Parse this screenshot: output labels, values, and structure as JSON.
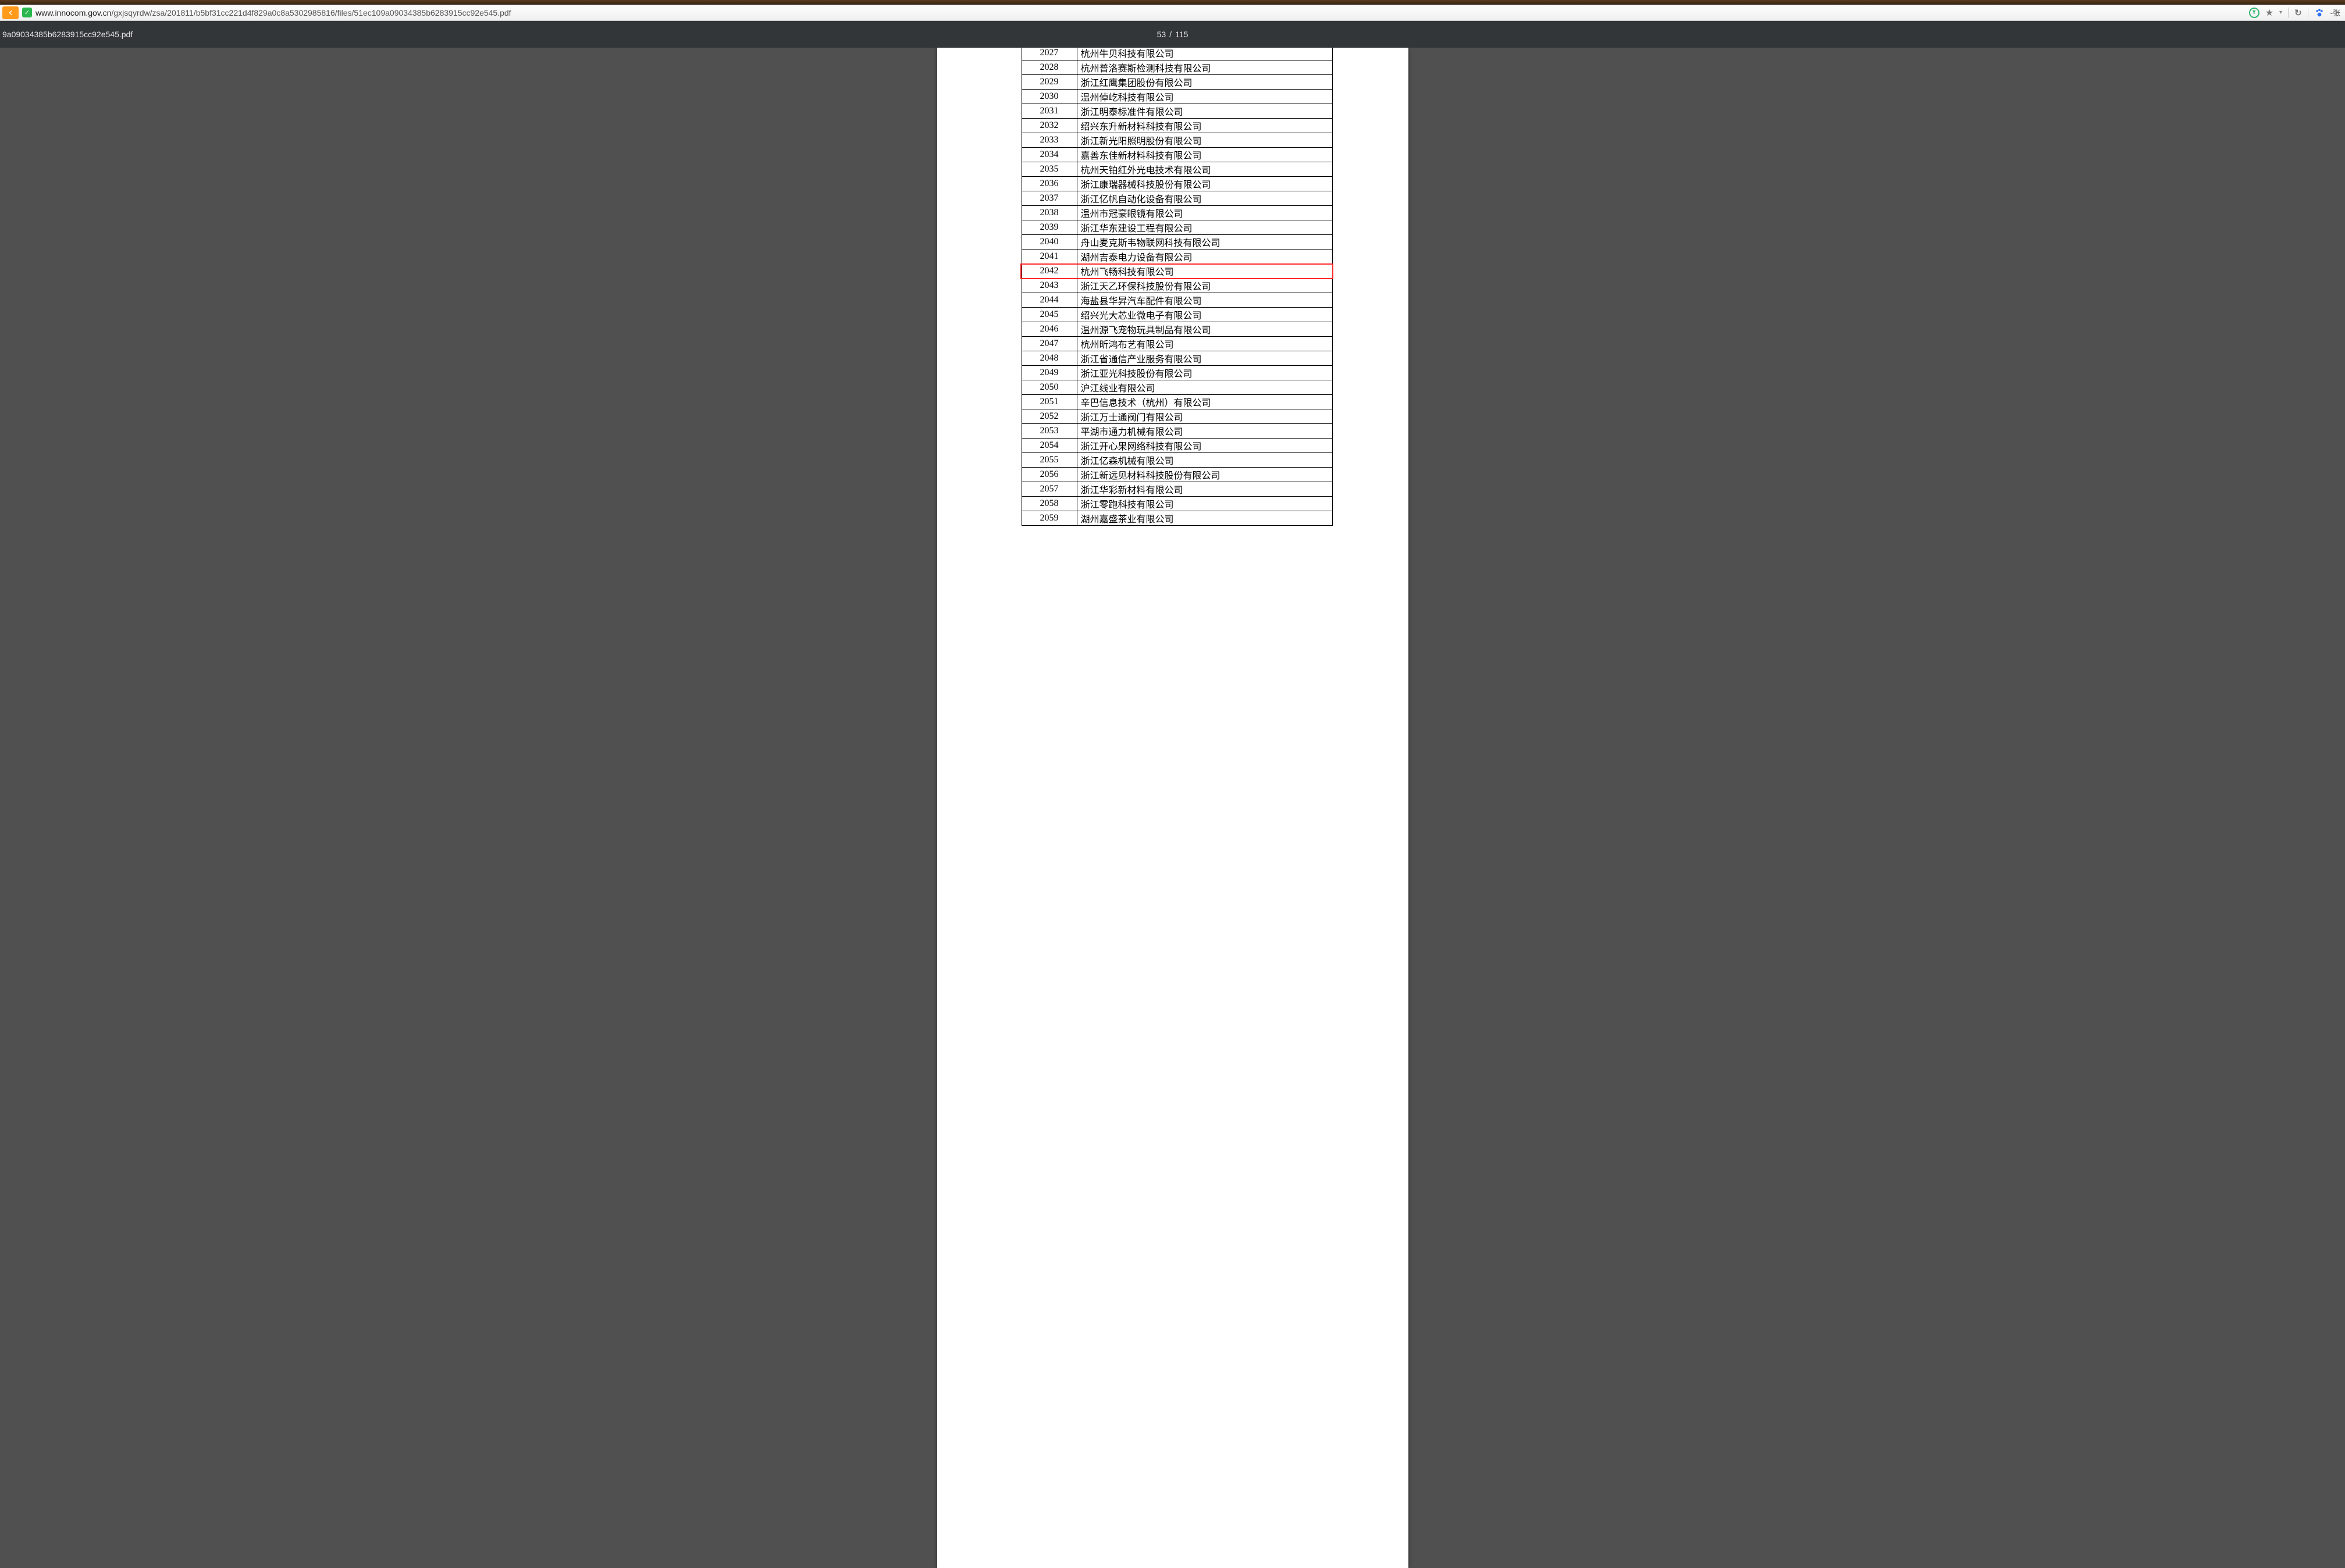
{
  "browser": {
    "url_domain": "www.innocom.gov.cn",
    "url_path": "/gxjsqyrdw/zsa/201811/b5bf31cc221d4f829a0c8a5302985816/files/51ec109a09034385b6283915cc92e545.pdf",
    "user_label": "张"
  },
  "pdf": {
    "title": "9a09034385b6283915cc92e545.pdf",
    "page_current": "53",
    "page_sep": "/",
    "page_total": "115"
  },
  "highlighted_row_number": "2042",
  "rows": [
    {
      "n": "2027",
      "name": "杭州牛贝科技有限公司"
    },
    {
      "n": "2028",
      "name": "杭州普洛赛斯检测科技有限公司"
    },
    {
      "n": "2029",
      "name": "浙江红鹰集团股份有限公司"
    },
    {
      "n": "2030",
      "name": "温州倬屹科技有限公司"
    },
    {
      "n": "2031",
      "name": "浙江明泰标准件有限公司"
    },
    {
      "n": "2032",
      "name": "绍兴东升新材料科技有限公司"
    },
    {
      "n": "2033",
      "name": "浙江新光阳照明股份有限公司"
    },
    {
      "n": "2034",
      "name": "嘉善东佳新材料科技有限公司"
    },
    {
      "n": "2035",
      "name": "杭州天铂红外光电技术有限公司"
    },
    {
      "n": "2036",
      "name": "浙江康瑞器械科技股份有限公司"
    },
    {
      "n": "2037",
      "name": "浙江亿帆自动化设备有限公司"
    },
    {
      "n": "2038",
      "name": "温州市冠豪眼镜有限公司"
    },
    {
      "n": "2039",
      "name": "浙江华东建设工程有限公司"
    },
    {
      "n": "2040",
      "name": "舟山麦克斯韦物联网科技有限公司"
    },
    {
      "n": "2041",
      "name": "湖州吉泰电力设备有限公司"
    },
    {
      "n": "2042",
      "name": "杭州飞畅科技有限公司"
    },
    {
      "n": "2043",
      "name": "浙江天乙环保科技股份有限公司"
    },
    {
      "n": "2044",
      "name": "海盐县华昇汽车配件有限公司"
    },
    {
      "n": "2045",
      "name": "绍兴光大芯业微电子有限公司"
    },
    {
      "n": "2046",
      "name": "温州源飞宠物玩具制品有限公司"
    },
    {
      "n": "2047",
      "name": "杭州昕鸿布艺有限公司"
    },
    {
      "n": "2048",
      "name": "浙江省通信产业服务有限公司"
    },
    {
      "n": "2049",
      "name": "浙江亚光科技股份有限公司"
    },
    {
      "n": "2050",
      "name": "沪江线业有限公司"
    },
    {
      "n": "2051",
      "name": "辛巴信息技术（杭州）有限公司"
    },
    {
      "n": "2052",
      "name": "浙江万士通阀门有限公司"
    },
    {
      "n": "2053",
      "name": "平湖市通力机械有限公司"
    },
    {
      "n": "2054",
      "name": "浙江开心果网络科技有限公司"
    },
    {
      "n": "2055",
      "name": "浙江亿森机械有限公司"
    },
    {
      "n": "2056",
      "name": "浙江新远见材料科技股份有限公司"
    },
    {
      "n": "2057",
      "name": "浙江华彩新材料有限公司"
    },
    {
      "n": "2058",
      "name": "浙江零跑科技有限公司"
    },
    {
      "n": "2059",
      "name": "湖州嘉盛茶业有限公司"
    }
  ]
}
